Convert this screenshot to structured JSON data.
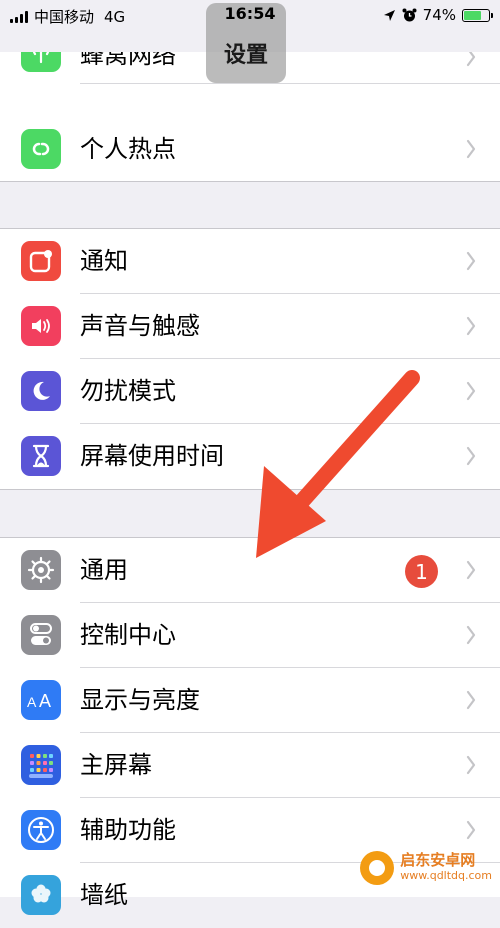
{
  "status_bar": {
    "carrier": "中国移动",
    "network": "4G",
    "time": "16:54",
    "battery": "74%",
    "battery_level": 0.74
  },
  "nav": {
    "title": "设置"
  },
  "groups": [
    {
      "rows": [
        {
          "label": "蜂窝网络",
          "icon": "cellular-antenna-icon",
          "color": "#4cd964"
        },
        {
          "label": "个人热点",
          "icon": "hotspot-link-icon",
          "color": "#4cd964"
        }
      ]
    },
    {
      "rows": [
        {
          "label": "通知",
          "icon": "notification-icon",
          "color": "#f04a3f"
        },
        {
          "label": "声音与触感",
          "icon": "speaker-icon",
          "color": "#f23f5e"
        },
        {
          "label": "勿扰模式",
          "icon": "moon-icon",
          "color": "#5b55d6"
        },
        {
          "label": "屏幕使用时间",
          "icon": "hourglass-icon",
          "color": "#5b55d6"
        }
      ]
    },
    {
      "rows": [
        {
          "label": "通用",
          "icon": "gear-icon",
          "color": "#8e8e93",
          "badge": "1"
        },
        {
          "label": "控制中心",
          "icon": "toggles-icon",
          "color": "#8e8e93"
        },
        {
          "label": "显示与亮度",
          "icon": "text-size-icon",
          "color": "#2f7bf5"
        },
        {
          "label": "主屏幕",
          "icon": "home-grid-icon",
          "color": "#2f5fe0"
        },
        {
          "label": "辅助功能",
          "icon": "accessibility-icon",
          "color": "#2f7bf5"
        },
        {
          "label": "墙纸",
          "icon": "wallpaper-flower-icon",
          "color": "#35a3dc"
        }
      ]
    }
  ],
  "watermark": {
    "name": "启东安卓网",
    "url": "www.qdltdq.com"
  }
}
